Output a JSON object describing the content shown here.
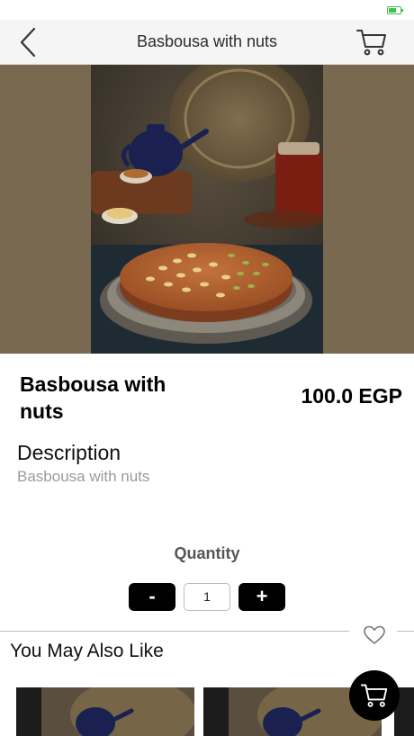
{
  "nav": {
    "title": "Basbousa with nuts"
  },
  "product": {
    "name": "Basbousa with nuts",
    "price": "100.0 EGP"
  },
  "description": {
    "heading": "Description",
    "text": "Basbousa with nuts"
  },
  "quantity": {
    "label": "Quantity",
    "minus": "-",
    "plus": "+",
    "value": "1"
  },
  "related": {
    "title": "You May Also Like"
  },
  "colors": {
    "accent": "#000000",
    "hero_background": "#7a6951",
    "battery": "#3cc24a"
  },
  "icons": [
    "back-chevron-icon",
    "cart-icon",
    "heart-icon",
    "battery-icon"
  ]
}
